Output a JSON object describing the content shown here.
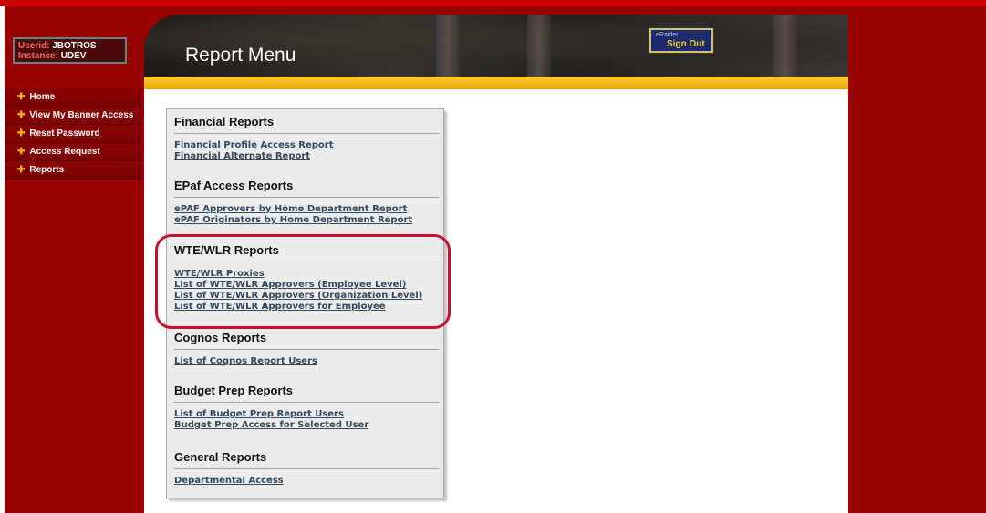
{
  "user": {
    "userid_label": "Userid:",
    "userid": "JBOTROS",
    "instance_label": "Instance:",
    "instance": "UDEV"
  },
  "nav": {
    "items": [
      {
        "label": "Home"
      },
      {
        "label": "View My Banner Access"
      },
      {
        "label": "Reset Password"
      },
      {
        "label": "Access Request"
      },
      {
        "label": "Reports"
      }
    ]
  },
  "header": {
    "title": "Report Menu",
    "signout_small": "eRaider",
    "signout_label": "Sign Out"
  },
  "sections": [
    {
      "title": "Financial Reports",
      "links": [
        "Financial Profile Access Report",
        "Financial Alternate Report"
      ]
    },
    {
      "title": "EPaf Access Reports",
      "links": [
        "ePAF Approvers by Home Department Report",
        "ePAF Originators by Home Department Report"
      ]
    },
    {
      "title": "WTE/WLR Reports",
      "links": [
        "WTE/WLR Proxies",
        "List of WTE/WLR Approvers (Employee Level)",
        "List of WTE/WLR Approvers (Organization Level)",
        "List of WTE/WLR Approvers for Employee"
      ]
    },
    {
      "title": "Cognos Reports",
      "links": [
        "List of Cognos Report Users"
      ]
    },
    {
      "title": "Budget Prep Reports",
      "links": [
        "List of Budget Prep Report Users",
        "Budget Prep Access for Selected User"
      ]
    },
    {
      "title": "General Reports",
      "links": [
        "Departmental Access"
      ]
    }
  ],
  "colors": {
    "frame": "#990000",
    "accent_gold": "#ffcc33",
    "highlight": "#c8102e",
    "link": "#34495e"
  }
}
